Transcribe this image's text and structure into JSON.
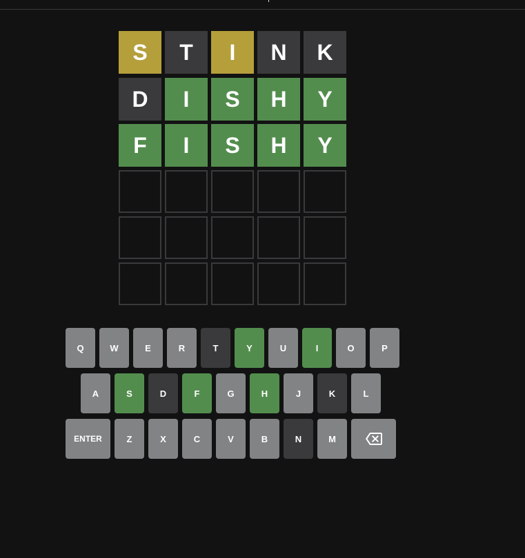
{
  "board": {
    "rows": [
      [
        {
          "letter": "S",
          "state": "present"
        },
        {
          "letter": "T",
          "state": "absent"
        },
        {
          "letter": "I",
          "state": "present"
        },
        {
          "letter": "N",
          "state": "absent"
        },
        {
          "letter": "K",
          "state": "absent"
        }
      ],
      [
        {
          "letter": "D",
          "state": "absent"
        },
        {
          "letter": "I",
          "state": "correct"
        },
        {
          "letter": "S",
          "state": "correct"
        },
        {
          "letter": "H",
          "state": "correct"
        },
        {
          "letter": "Y",
          "state": "correct"
        }
      ],
      [
        {
          "letter": "F",
          "state": "correct"
        },
        {
          "letter": "I",
          "state": "correct"
        },
        {
          "letter": "S",
          "state": "correct"
        },
        {
          "letter": "H",
          "state": "correct"
        },
        {
          "letter": "Y",
          "state": "correct"
        }
      ],
      [
        {
          "letter": "",
          "state": "empty"
        },
        {
          "letter": "",
          "state": "empty"
        },
        {
          "letter": "",
          "state": "empty"
        },
        {
          "letter": "",
          "state": "empty"
        },
        {
          "letter": "",
          "state": "empty"
        }
      ],
      [
        {
          "letter": "",
          "state": "empty"
        },
        {
          "letter": "",
          "state": "empty"
        },
        {
          "letter": "",
          "state": "empty"
        },
        {
          "letter": "",
          "state": "empty"
        },
        {
          "letter": "",
          "state": "empty"
        }
      ],
      [
        {
          "letter": "",
          "state": "empty"
        },
        {
          "letter": "",
          "state": "empty"
        },
        {
          "letter": "",
          "state": "empty"
        },
        {
          "letter": "",
          "state": "empty"
        },
        {
          "letter": "",
          "state": "empty"
        }
      ]
    ]
  },
  "keyboard": {
    "rows": [
      [
        {
          "label": "Q",
          "state": "unused"
        },
        {
          "label": "W",
          "state": "unused"
        },
        {
          "label": "E",
          "state": "unused"
        },
        {
          "label": "R",
          "state": "unused"
        },
        {
          "label": "T",
          "state": "absent"
        },
        {
          "label": "Y",
          "state": "correct"
        },
        {
          "label": "U",
          "state": "unused"
        },
        {
          "label": "I",
          "state": "correct"
        },
        {
          "label": "O",
          "state": "unused"
        },
        {
          "label": "P",
          "state": "unused"
        }
      ],
      [
        {
          "label": "A",
          "state": "unused"
        },
        {
          "label": "S",
          "state": "correct"
        },
        {
          "label": "D",
          "state": "absent"
        },
        {
          "label": "F",
          "state": "correct"
        },
        {
          "label": "G",
          "state": "unused"
        },
        {
          "label": "H",
          "state": "correct"
        },
        {
          "label": "J",
          "state": "unused"
        },
        {
          "label": "K",
          "state": "absent"
        },
        {
          "label": "L",
          "state": "unused"
        }
      ],
      [
        {
          "label": "ENTER",
          "state": "unused",
          "wide": true
        },
        {
          "label": "Z",
          "state": "unused"
        },
        {
          "label": "X",
          "state": "unused"
        },
        {
          "label": "C",
          "state": "unused"
        },
        {
          "label": "V",
          "state": "unused"
        },
        {
          "label": "B",
          "state": "unused"
        },
        {
          "label": "N",
          "state": "absent"
        },
        {
          "label": "M",
          "state": "unused"
        },
        {
          "label": "",
          "state": "unused",
          "wide": true,
          "icon": "backspace-icon"
        }
      ]
    ]
  },
  "colors": {
    "background": "#121213",
    "correct": "#538d4e",
    "present": "#b59f3b",
    "absent": "#3a3a3c",
    "unused_key": "#818384",
    "empty_border": "#3a3a3c"
  }
}
